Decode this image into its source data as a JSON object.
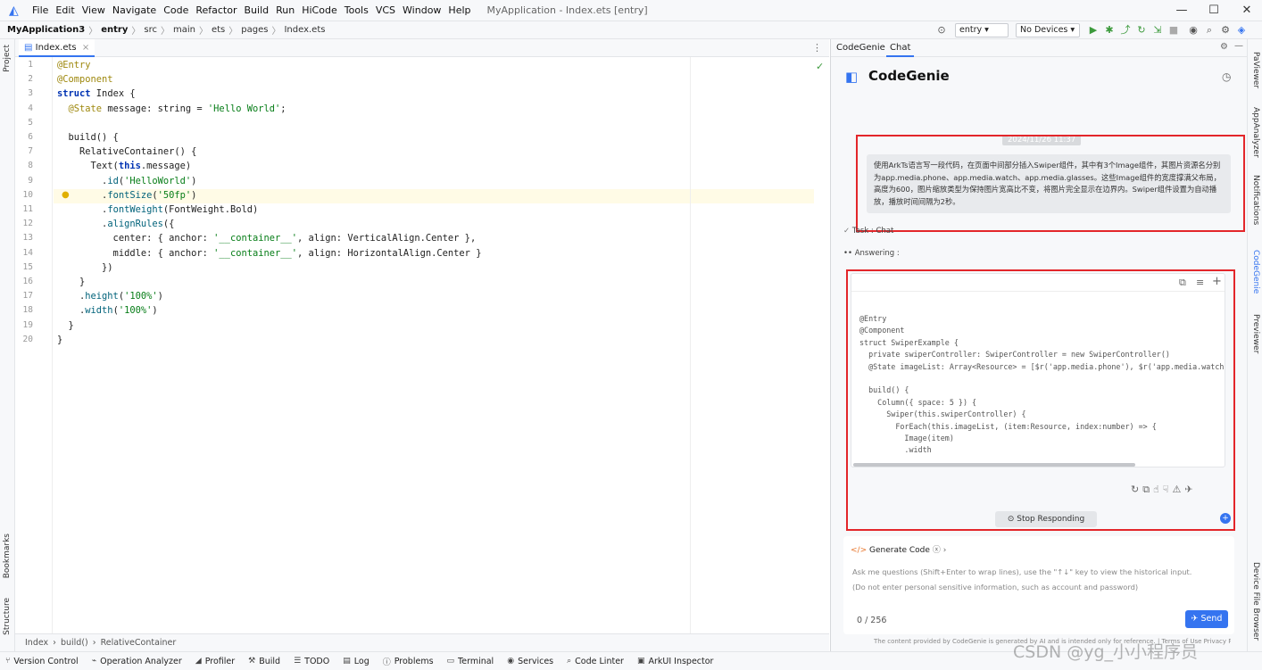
{
  "menubar": {
    "items": [
      "File",
      "Edit",
      "View",
      "Navigate",
      "Code",
      "Refactor",
      "Build",
      "Run",
      "HiCode",
      "Tools",
      "VCS",
      "Window",
      "Help"
    ],
    "window_title": "MyApplication - Index.ets [entry]"
  },
  "navbar": {
    "crumbs": [
      "MyApplication3",
      "entry",
      "src",
      "main",
      "ets",
      "pages",
      "Index.ets"
    ],
    "module_select": "entry",
    "device_select": "No Devices"
  },
  "left_strip": {
    "top": "Project",
    "mid": "Bookmarks",
    "bottom": "Structure"
  },
  "right_strip": [
    "PaViewer",
    "AppAnalyzer",
    "Notifications",
    "CodeGenie",
    "Previewer",
    "Device File Browser"
  ],
  "editor": {
    "tab_label": "Index.ets",
    "lines": [
      "@Entry",
      "@Component",
      "struct Index {",
      "  @State message: string = 'Hello World';",
      "",
      "  build() {",
      "    RelativeContainer() {",
      "      Text(this.message)",
      "        .id('HelloWorld')",
      "        .fontSize('50fp')",
      "        .fontWeight(FontWeight.Bold)",
      "        .alignRules({",
      "          center: { anchor: '__container__', align: VerticalAlign.Center },",
      "          middle: { anchor: '__container__', align: HorizontalAlign.Center }",
      "        })",
      "    }",
      "    .height('100%')",
      "    .width('100%')",
      "  }",
      "}"
    ],
    "highlight_line": 10,
    "breadcrumb": [
      "Index",
      "build()",
      "RelativeContainer"
    ]
  },
  "panel": {
    "tabs": [
      "CodeGenie",
      "Chat"
    ],
    "active_tab": "Chat",
    "title": "CodeGenie",
    "timestamp": "2024/11/26 11:37",
    "user_message": "使用ArkTs语言写一段代码，在页面中间部分插入Swiper组件，其中有3个Image组件，其图片资源名分别为app.media.phone、app.media.watch、app.media.glasses。这些Image组件的宽度撑满父布局，高度为600，图片缩放类型为保持图片宽高比不变，将图片完全显示在边界内。Swiper组件设置为自动播放，播放时间间隔为2秒。",
    "task_status": "Task : Chat",
    "answering": "Answering :",
    "code_lines": [
      "@Entry",
      "@Component",
      "struct SwiperExample {",
      "  private swiperController: SwiperController = new SwiperController()",
      "  @State imageList: Array<Resource> = [$r('app.media.phone'), $r('app.media.watch'),",
      "",
      "  build() {",
      "    Column({ space: 5 }) {",
      "      Swiper(this.swiperController) {",
      "        ForEach(this.imageList, (item:Resource, index:number) => {",
      "          Image(item)",
      "          .width"
    ],
    "stop_button": "Stop Responding",
    "generate_code": "Generate Code",
    "input_hint_1": "Ask me questions (Shift+Enter to wrap lines), use the \"↑↓\" key to view the historical input.",
    "input_hint_2": "(Do not enter personal sensitive information, such as account and password)",
    "char_count": "0 / 256",
    "send_label": "Send",
    "footer": "The content provided by CodeGenie is generated by AI and is intended only for reference.  |  Terms of Use  Privacy Policy"
  },
  "bottom_tools": [
    "Version Control",
    "Operation Analyzer",
    "Profiler",
    "Build",
    "TODO",
    "Log",
    "Problems",
    "Terminal",
    "Services",
    "Code Linter",
    "ArkUI Inspector"
  ],
  "watermark": "CSDN @yg_小小程序员",
  "colors": {
    "accent": "#3574f0",
    "highlight_box": "#e3262a",
    "keyword": "#0033b3",
    "string": "#067d17",
    "annotation": "#9e880d"
  }
}
